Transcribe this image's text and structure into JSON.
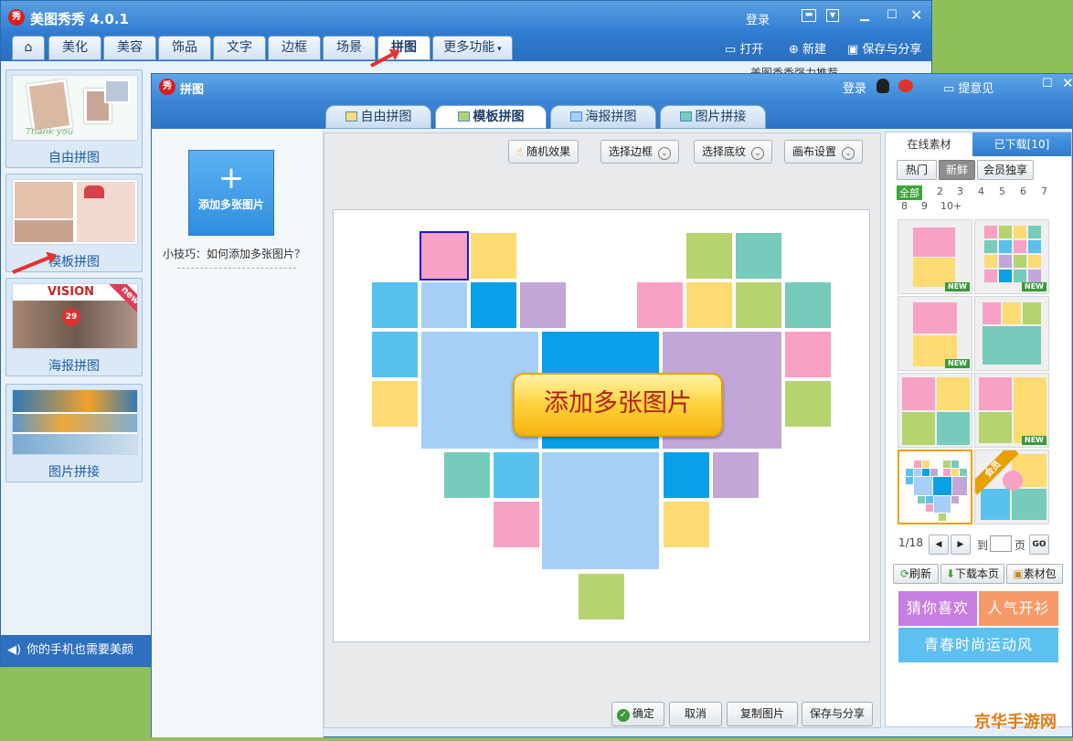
{
  "main": {
    "title": "美图秀秀 4.0.1",
    "logo": "秀",
    "login": "登录",
    "tabs": [
      "美化",
      "美容",
      "饰品",
      "文字",
      "边框",
      "场景",
      "拼图",
      "更多功能"
    ],
    "active_tab": "拼图",
    "toolbar": {
      "open": "打开",
      "new": "新建",
      "save_share": "保存与分享"
    },
    "behind_text": "美图秀秀强力推荐"
  },
  "left_panel": {
    "cards": [
      {
        "label": "自由拼图",
        "thumb_text": "Thank you"
      },
      {
        "label": "模板拼图"
      },
      {
        "label": "海报拼图",
        "thumb_text": "VISION",
        "badge": "new",
        "sticker": "29"
      },
      {
        "label": "图片拼接"
      }
    ],
    "phone_promo": "你的手机也需要美颜"
  },
  "dialog": {
    "title": "拼图",
    "login": "登录",
    "feedback": "提意见",
    "tabs": [
      "自由拼图",
      "模板拼图",
      "海报拼图",
      "图片拼接"
    ],
    "active_tab": "模板拼图",
    "add_multi": "添加多张图片",
    "tip": "小技巧：如何添加多张图片？",
    "toolbar": {
      "random": "随机效果",
      "border": "选择边框",
      "texture": "选择底纹",
      "canvas": "画布设置"
    },
    "canvas_button": "添加多张图片",
    "bottom": {
      "ok": "确定",
      "cancel": "取消",
      "copy": "复制图片",
      "save_share": "保存与分享"
    }
  },
  "right_panel": {
    "tabs": [
      "在线素材",
      "已下载[10]"
    ],
    "subtabs": [
      "热门",
      "新鲜",
      "会员独享"
    ],
    "active_subtab": "新鲜",
    "filters": [
      "全部",
      "2",
      "3",
      "4",
      "5",
      "6",
      "7",
      "8",
      "9",
      "10+"
    ],
    "active_filter": "全部",
    "new_badge": "NEW",
    "member_badge": "会员",
    "pager": {
      "page": "1/18",
      "to": "到",
      "unit": "页",
      "go": "GO"
    },
    "actions": {
      "refresh": "刷新",
      "download_page": "下载本页",
      "pack": "素材包"
    },
    "banners": [
      {
        "text": "猜你喜欢",
        "color": "#c77ee0"
      },
      {
        "text": "人气开衫",
        "color": "#f79a6a"
      },
      {
        "text": "青春时尚运动风",
        "color": "#5cc0f0"
      }
    ]
  },
  "watermark": "京华手游网",
  "colors": {
    "pink": "#f7a1c4",
    "yellow": "#fddb73",
    "green": "#b5d36f",
    "teal": "#76cbba",
    "lightblue": "#58c1ee",
    "paleblue": "#a5cff6",
    "blue": "#0aa0e8",
    "purple": "#c2a6d8"
  }
}
